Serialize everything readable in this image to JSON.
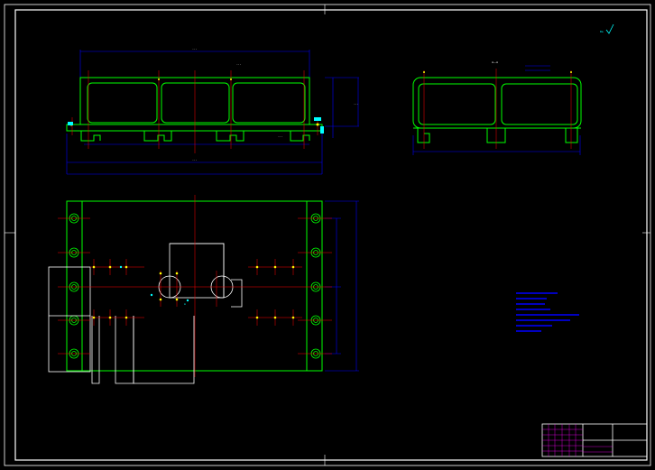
{
  "drawing": {
    "section_label": "A—A",
    "section_marker": "A",
    "notes": {
      "title": "",
      "items": []
    },
    "title_block": {
      "part_name": "",
      "rows": 6
    }
  },
  "colors": {
    "background": "#000000",
    "frame": "#ffffff",
    "outline": "#00ff00",
    "dimension": "#0000ff",
    "centerline": "#ff0000",
    "annotation": "#00ffff",
    "hole_marker": "#ffff00",
    "title_block_text": "#ff00ff"
  },
  "icons": {
    "roughness_symbol": "surface-roughness-icon"
  }
}
